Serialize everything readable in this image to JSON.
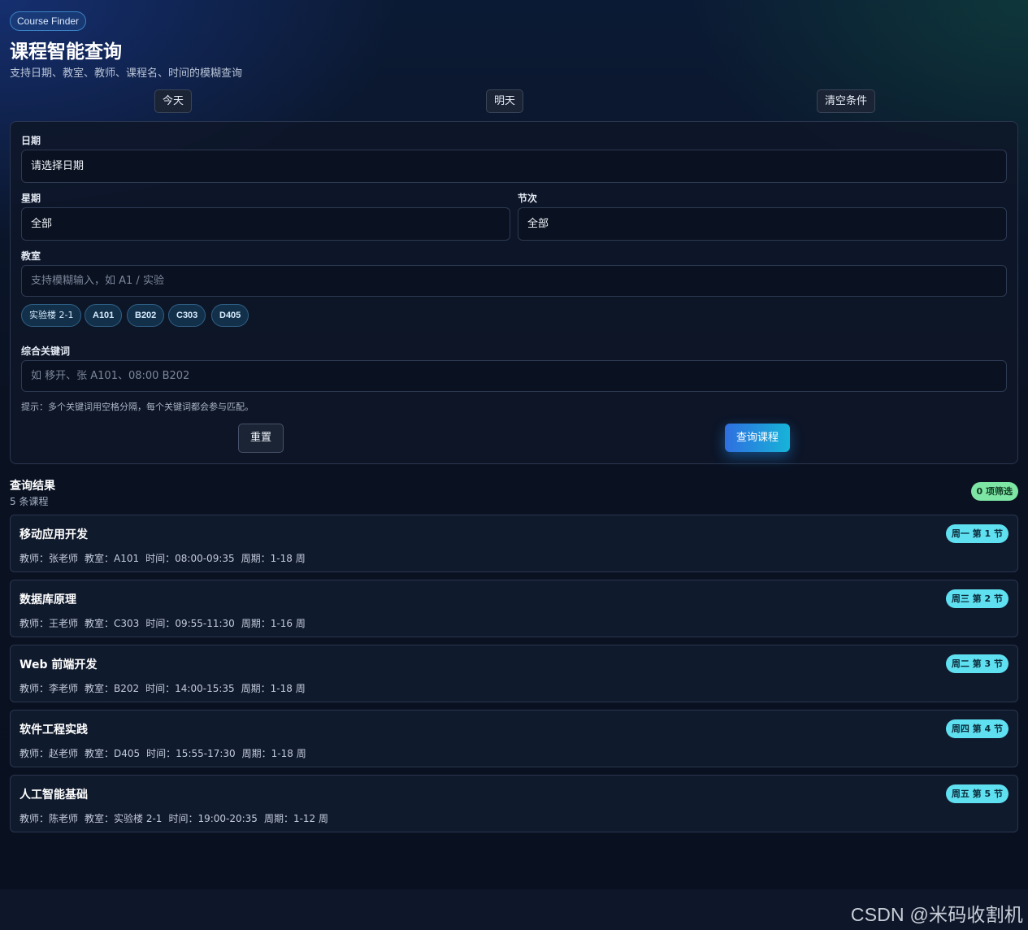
{
  "app": {
    "brand": "Course Finder",
    "title": "课程智能查询",
    "subtitle": "支持日期、教室、教师、课程名、时间的模糊查询"
  },
  "quick_actions": {
    "today": "今天",
    "tomorrow": "明天",
    "clear": "清空条件"
  },
  "form": {
    "date": {
      "label": "日期",
      "value": "请选择日期"
    },
    "weekday": {
      "label": "星期",
      "value": "全部"
    },
    "period": {
      "label": "节次",
      "value": "全部"
    },
    "classroom": {
      "label": "教室",
      "placeholder": "支持模糊输入，如 A1 / 实验"
    },
    "room_chips": [
      "实验楼 2-1",
      "A101",
      "B202",
      "C303",
      "D405"
    ],
    "keyword": {
      "label": "综合关键词",
      "placeholder": "如 移开、张 A101、08:00 B202"
    },
    "hint": "提示：多个关键词用空格分隔，每个关键词都会参与匹配。",
    "reset_label": "重置",
    "search_label": "查询课程"
  },
  "results": {
    "title": "查询结果",
    "count": "5 条课程",
    "filter_badge": "0 项筛选",
    "courses": [
      {
        "name": "移动应用开发",
        "slot": "周一 第 1 节",
        "teacher": "教师：张老师",
        "room": "教室：A101",
        "time": "时间：08:00-09:35",
        "weeks": "周期：1-18 周"
      },
      {
        "name": "数据库原理",
        "slot": "周三 第 2 节",
        "teacher": "教师：王老师",
        "room": "教室：C303",
        "time": "时间：09:55-11:30",
        "weeks": "周期：1-16 周"
      },
      {
        "name": "Web 前端开发",
        "slot": "周二 第 3 节",
        "teacher": "教师：李老师",
        "room": "教室：B202",
        "time": "时间：14:00-15:35",
        "weeks": "周期：1-18 周"
      },
      {
        "name": "软件工程实践",
        "slot": "周四 第 4 节",
        "teacher": "教师：赵老师",
        "room": "教室：D405",
        "time": "时间：15:55-17:30",
        "weeks": "周期：1-18 周"
      },
      {
        "name": "人工智能基础",
        "slot": "周五 第 5 节",
        "teacher": "教师：陈老师",
        "room": "教室：实验楼 2-1",
        "time": "时间：19:00-20:35",
        "weeks": "周期：1-12 周"
      }
    ]
  },
  "watermark": "CSDN @米码收割机"
}
